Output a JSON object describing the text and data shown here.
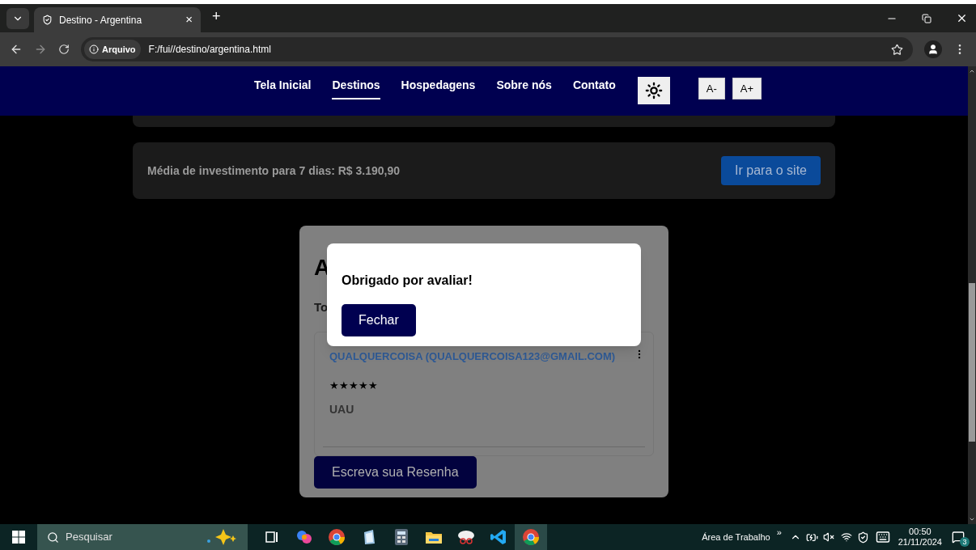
{
  "browser": {
    "tab_title": "Destino - Argentina",
    "tab_close": "×",
    "new_tab": "+",
    "site_chip": "Arquivo",
    "url": "F:/fui//destino/argentina.html"
  },
  "nav": {
    "items": [
      {
        "label": "Tela Inicial",
        "selected": false
      },
      {
        "label": "Destinos",
        "selected": true
      },
      {
        "label": "Hospedagens",
        "selected": false
      },
      {
        "label": "Sobre nós",
        "selected": false
      },
      {
        "label": "Contato",
        "selected": false
      }
    ],
    "font_buttons": [
      "A-",
      "A+"
    ]
  },
  "investment": {
    "text": "Média de investimento para 7 dias: R$ 3.190,90",
    "button": "Ir para o site"
  },
  "reviews": {
    "heading": "A",
    "subheading": "To",
    "items": [
      {
        "author": "QUALQUERCOISA (QUALQUERCOISA123@GMAIL.COM)",
        "stars": 5,
        "text": "UAU"
      }
    ],
    "write_button": "Escreva sua Resenha"
  },
  "modal": {
    "message": "Obrigado por avaliar!",
    "button": "Fechar"
  },
  "taskbar": {
    "search_placeholder": "Pesquisar",
    "desktop_label": "Área de Trabalho",
    "overflow": "»",
    "time": "00:50",
    "date": "21/11/2024",
    "notifications": "3"
  }
}
